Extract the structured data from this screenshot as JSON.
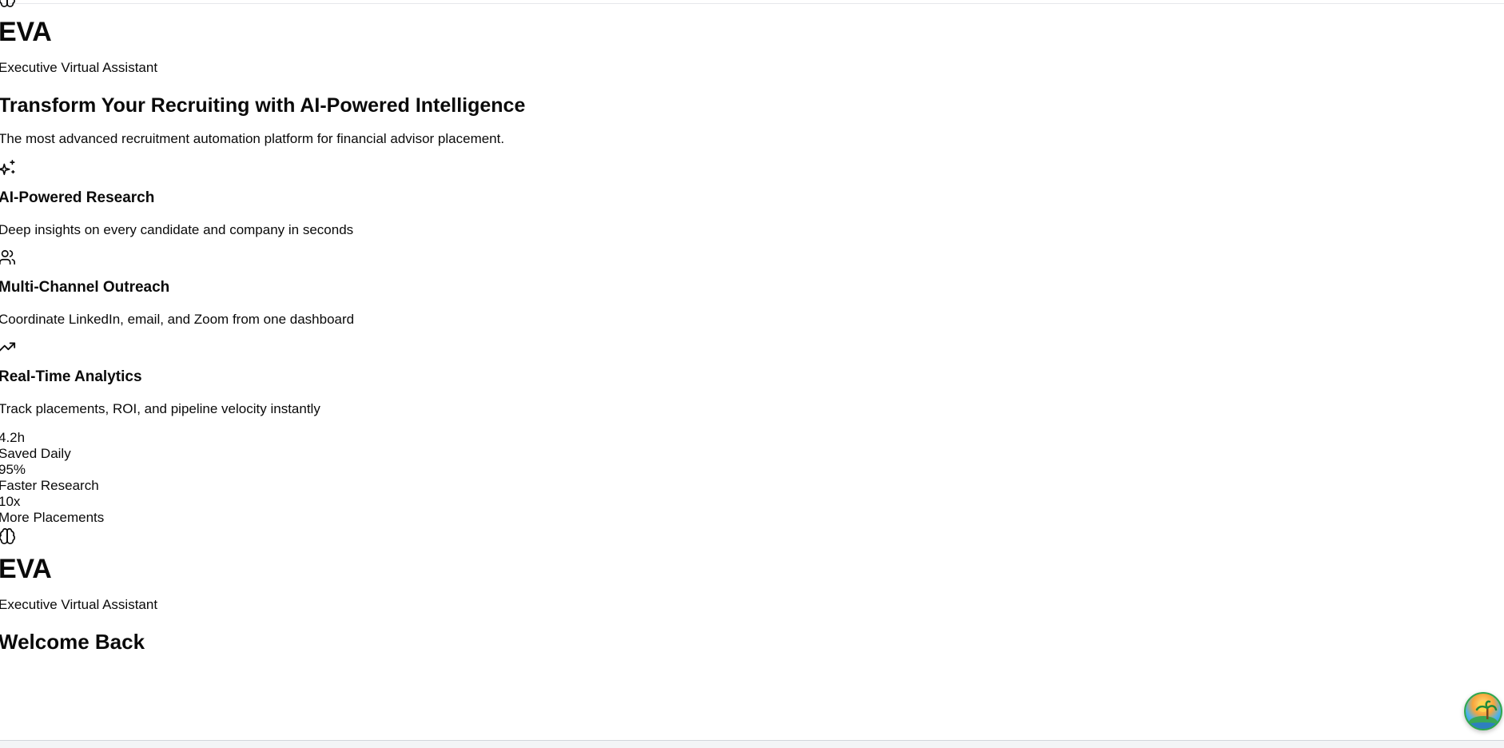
{
  "hero_section": {
    "brand": "EVA",
    "brand_subtitle": "Executive Virtual Assistant",
    "headline": "Transform Your Recruiting with AI-Powered Intelligence",
    "description": "The most advanced recruitment automation platform for financial advisor placement.",
    "features": [
      {
        "icon": "sparkles-icon",
        "title": "AI-Powered Research",
        "description": "Deep insights on every candidate and company in seconds"
      },
      {
        "icon": "users-icon",
        "title": "Multi-Channel Outreach",
        "description": "Coordinate LinkedIn, email, and Zoom from one dashboard"
      },
      {
        "icon": "trending-up-icon",
        "title": "Real-Time Analytics",
        "description": "Track placements, ROI, and pipeline velocity instantly"
      }
    ],
    "stats": [
      {
        "value": "4.2h",
        "label": "Saved Daily"
      },
      {
        "value": "95%",
        "label": "Faster Research"
      },
      {
        "value": "10x",
        "label": "More Placements"
      }
    ]
  },
  "login_section": {
    "brand": "EVA",
    "brand_subtitle": "Executive Virtual Assistant",
    "title": "Welcome Back"
  },
  "floating_widget": {
    "icon": "island-avatar-icon"
  }
}
